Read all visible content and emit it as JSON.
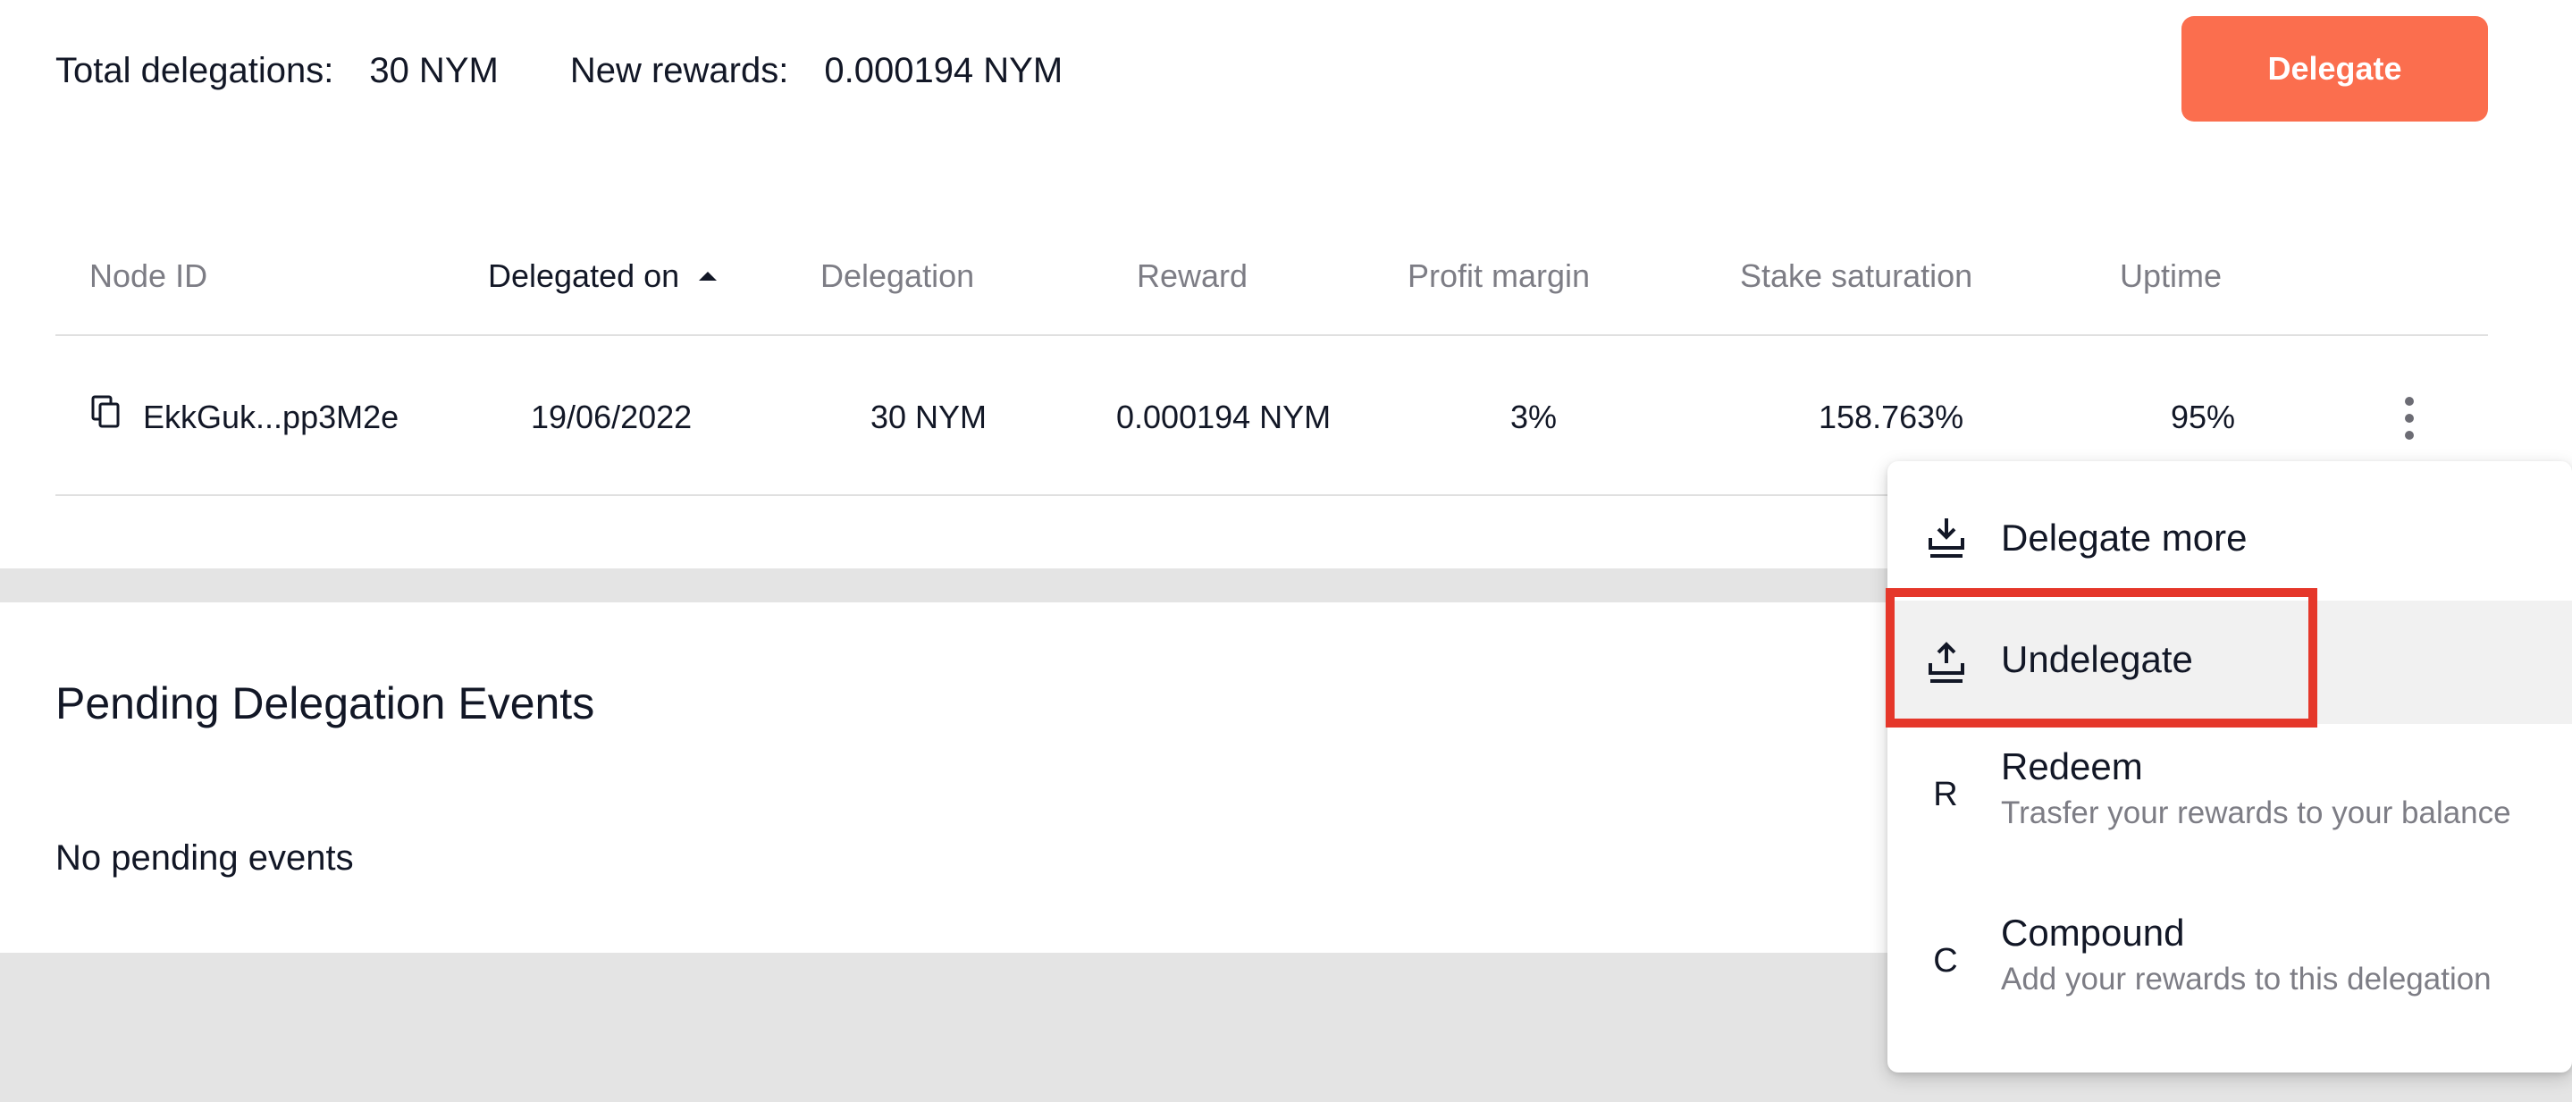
{
  "summary": {
    "total_label": "Total delegations:",
    "total_value": "30 NYM",
    "rewards_label": "New rewards:",
    "rewards_value": "0.000194 NYM"
  },
  "delegate_button": "Delegate",
  "table": {
    "columns": [
      "Node ID",
      "Delegated on",
      "Delegation",
      "Reward",
      "Profit margin",
      "Stake saturation",
      "Uptime"
    ],
    "sorted_column": "Delegated on",
    "sort_direction": "ascending",
    "rows": [
      {
        "node_id": "EkkGuk...pp3M2e",
        "delegated_on": "19/06/2022",
        "delegation": "30 NYM",
        "reward": "0.000194 NYM",
        "profit_margin": "3%",
        "stake_saturation": "158.763%",
        "uptime": "95%"
      }
    ]
  },
  "pending": {
    "title": "Pending Delegation Events",
    "empty_text": "No pending events"
  },
  "menu": {
    "items": [
      {
        "title": "Delegate more",
        "icon": "download-tray-icon"
      },
      {
        "title": "Undelegate",
        "icon": "upload-tray-icon",
        "hovered": true
      },
      {
        "title": "Redeem",
        "letter": "R",
        "subtitle": "Trasfer your rewards to your balance"
      },
      {
        "title": "Compound",
        "letter": "C",
        "subtitle": "Add your rewards to this delegation"
      }
    ]
  },
  "colors": {
    "accent": "#fb6e4e",
    "highlight_box": "#e5372a",
    "text_primary": "#121726",
    "text_muted": "#7d7d85"
  }
}
